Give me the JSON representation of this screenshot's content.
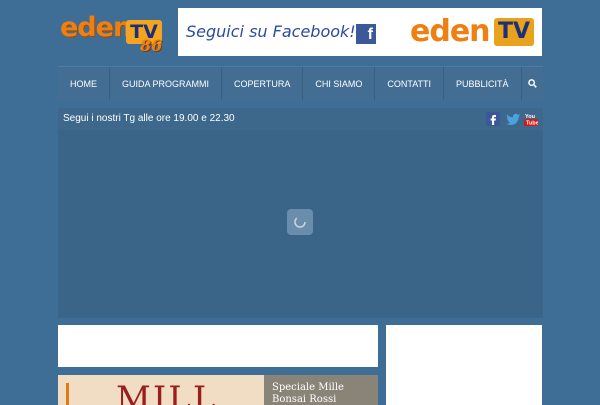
{
  "logo": {
    "word": "eden",
    "tv": "TV",
    "number": "86"
  },
  "banner": {
    "cta": "Seguici su Facebook!!",
    "fb_glyph": "f",
    "brand_word": "eden",
    "brand_tv": "TV"
  },
  "nav": {
    "items": [
      "HOME",
      "GUIDA PROGRAMMI",
      "COPERTURA",
      "CHI SIAMO",
      "CONTATTI",
      "PUBBLICITÀ"
    ],
    "search_icon": "search-icon"
  },
  "player": {
    "notice": "Segui i nostri Tg alle ore 19.00 e 22.30",
    "social_icons": [
      "facebook-icon",
      "twitter-icon",
      "youtube-icon"
    ],
    "youtube_text": "You Tube",
    "spinner_icon": "loading-spinner-icon"
  },
  "article": {
    "thumb_text": "MILL",
    "title": "Speciale Mille Bonsai Rossi"
  },
  "colors": {
    "background": "#3e6d96",
    "nav": "#436d92",
    "accent_orange": "#f07f12",
    "facebook": "#3b5998"
  }
}
